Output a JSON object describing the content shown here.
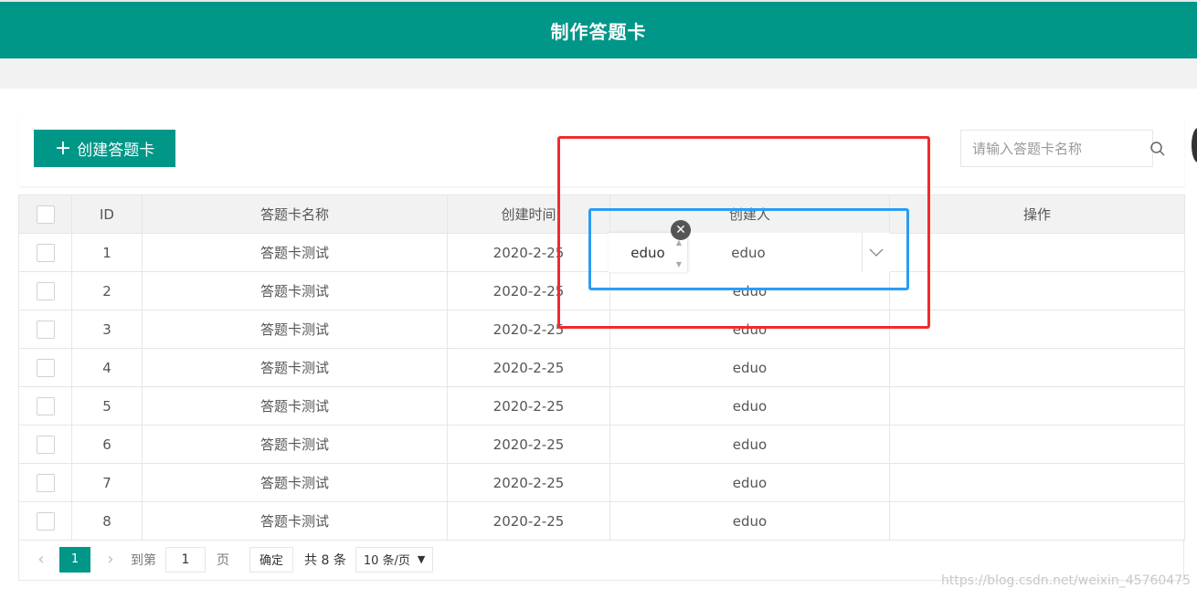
{
  "header": {
    "title": "制作答题卡"
  },
  "toolbar": {
    "create_label": "创建答题卡",
    "search_placeholder": "请输入答题卡名称"
  },
  "table": {
    "columns": [
      "ID",
      "答题卡名称",
      "创建时间",
      "创建人",
      "操作"
    ],
    "rows": [
      {
        "id": "1",
        "name": "答题卡测试",
        "time": "2020-2-25",
        "creator": "eduo"
      },
      {
        "id": "2",
        "name": "答题卡测试",
        "time": "2020-2-25",
        "creator": "eduo"
      },
      {
        "id": "3",
        "name": "答题卡测试",
        "time": "2020-2-25",
        "creator": "eduo"
      },
      {
        "id": "4",
        "name": "答题卡测试",
        "time": "2020-2-25",
        "creator": "eduo"
      },
      {
        "id": "5",
        "name": "答题卡测试",
        "time": "2020-2-25",
        "creator": "eduo"
      },
      {
        "id": "6",
        "name": "答题卡测试",
        "time": "2020-2-25",
        "creator": "eduo"
      },
      {
        "id": "7",
        "name": "答题卡测试",
        "time": "2020-2-25",
        "creator": "eduo"
      },
      {
        "id": "8",
        "name": "答题卡测试",
        "time": "2020-2-25",
        "creator": "eduo"
      }
    ]
  },
  "editor": {
    "input_value": "eduo",
    "display_value": "eduo"
  },
  "pager": {
    "current": "1",
    "goto_label": "到第",
    "page_input": "1",
    "page_unit": "页",
    "confirm": "确定",
    "total": "共 8 条",
    "page_size": "10 条/页"
  },
  "watermark": "https://blog.csdn.net/weixin_45760475",
  "colors": {
    "primary": "#009688",
    "red_annotation": "#f02b2b",
    "blue_annotation": "#2a9df4"
  }
}
